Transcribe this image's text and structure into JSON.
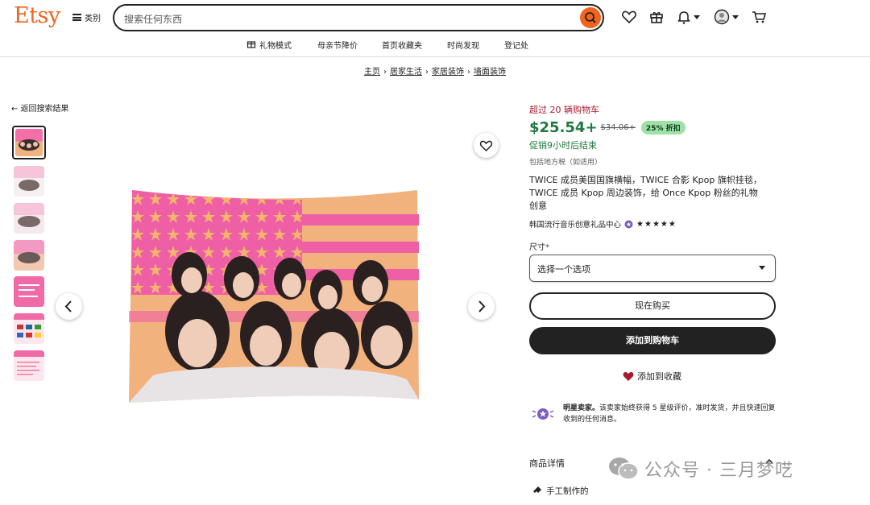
{
  "header": {
    "logo": "Etsy",
    "categories_label": "类别",
    "search_placeholder": "搜索任何东西"
  },
  "nav": [
    "礼物模式",
    "母亲节降价",
    "首页收藏夹",
    "时尚发现",
    "登记处"
  ],
  "breadcrumb": [
    "主页",
    "居家生活",
    "家居装饰",
    "墙面装饰"
  ],
  "back_label": "返回搜索结果",
  "product": {
    "cart_note": "超过 20 辆购物车",
    "price": "$25.54+",
    "old_price": "$34.06+",
    "discount": "25% 折扣",
    "sale_end": "促销9小时后结束",
    "tax": "包括地方税（如适用）",
    "title": "TWICE 成员美国国旗横幅，TWICE 合影 Kpop 旗帜挂毯，TWICE 成员 Kpop 周边装饰，给 Once Kpop 粉丝的礼物创意",
    "shop": "韩国流行音乐创意礼品中心",
    "stars": "★★★★★",
    "size_label": "尺寸",
    "size_required": "*",
    "size_select": "选择一个选项",
    "buy_now": "现在购买",
    "add_to_cart": "添加到购物车",
    "add_fav": "添加到收藏",
    "star_seller_title": "明星卖家。",
    "star_seller_text": "该卖家始终获得 5 星级评价，准时发货，并且快速回复收到的任何消息。",
    "details": "商品详情",
    "handmade": "手工制作的"
  },
  "watermark": "公众号 · 三月梦呓",
  "colors": {
    "brand": "#f1641e",
    "sale_green": "#1f7a3e",
    "alert_red": "#a61a2e"
  }
}
